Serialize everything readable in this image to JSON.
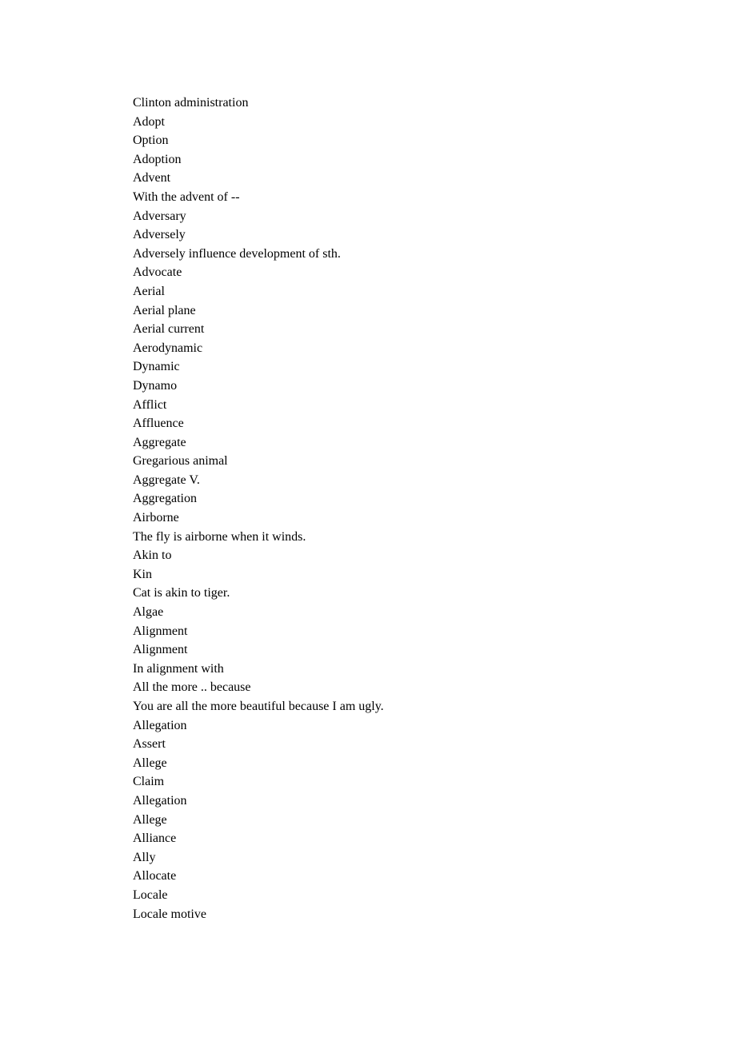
{
  "lines": [
    "Clinton administration",
    "Adopt",
    "Option",
    "Adoption",
    "Advent",
    "With the advent of --",
    "Adversary",
    "Adversely",
    "Adversely influence development of sth.",
    "Advocate",
    "Aerial",
    "Aerial plane",
    "Aerial current",
    "Aerodynamic",
    "Dynamic",
    "Dynamo",
    "Afflict",
    "Affluence",
    "Aggregate",
    "Gregarious animal",
    "Aggregate V.",
    "Aggregation",
    "Airborne",
    "The fly is airborne when it winds.",
    "Akin to",
    "Kin",
    "Cat is akin to tiger.",
    "Algae",
    "Alignment",
    "Alignment",
    "In alignment with",
    "All the more .. because",
    "You are all the more beautiful because I am ugly.",
    "Allegation",
    "Assert",
    "Allege",
    "Claim",
    "Allegation",
    "Allege",
    "Alliance",
    "Ally",
    "Allocate",
    "Locale",
    "Locale motive"
  ]
}
